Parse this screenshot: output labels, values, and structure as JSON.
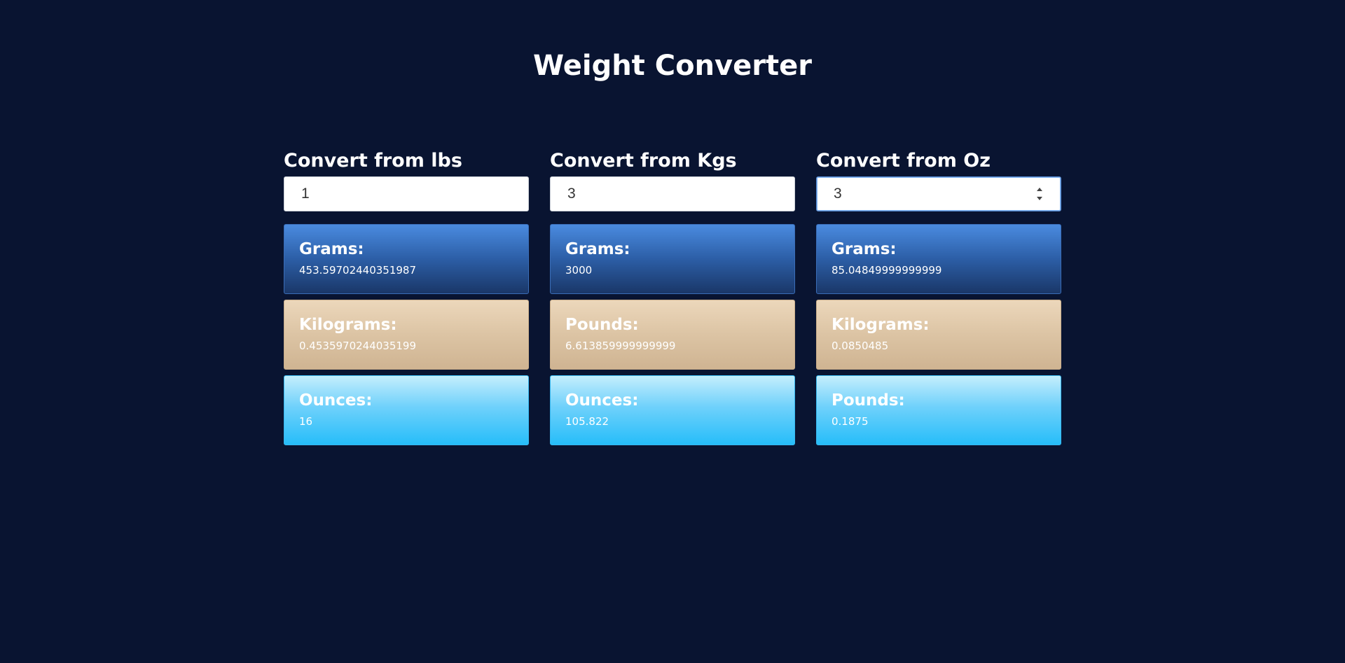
{
  "title": "Weight Converter",
  "columns": [
    {
      "label": "Convert from lbs",
      "input_value": "1",
      "results": [
        {
          "label": "Grams:",
          "value": "453.59702440351987"
        },
        {
          "label": "Kilograms:",
          "value": "0.4535970244035199"
        },
        {
          "label": "Ounces:",
          "value": "16"
        }
      ]
    },
    {
      "label": "Convert from Kgs",
      "input_value": "3",
      "results": [
        {
          "label": "Grams:",
          "value": "3000"
        },
        {
          "label": "Pounds:",
          "value": "6.613859999999999"
        },
        {
          "label": "Ounces:",
          "value": "105.822"
        }
      ]
    },
    {
      "label": "Convert from Oz",
      "input_value": "3",
      "results": [
        {
          "label": "Grams:",
          "value": "85.04849999999999"
        },
        {
          "label": "Kilograms:",
          "value": "0.0850485"
        },
        {
          "label": "Pounds:",
          "value": "0.1875"
        }
      ]
    }
  ],
  "colors": {
    "background": "#091431",
    "card_blue": "#2c5ea6",
    "card_tan": "#dcc4a4",
    "card_cyan": "#26bdf9",
    "focus_border": "#5a8fd6"
  },
  "focused_input": "oz-input"
}
